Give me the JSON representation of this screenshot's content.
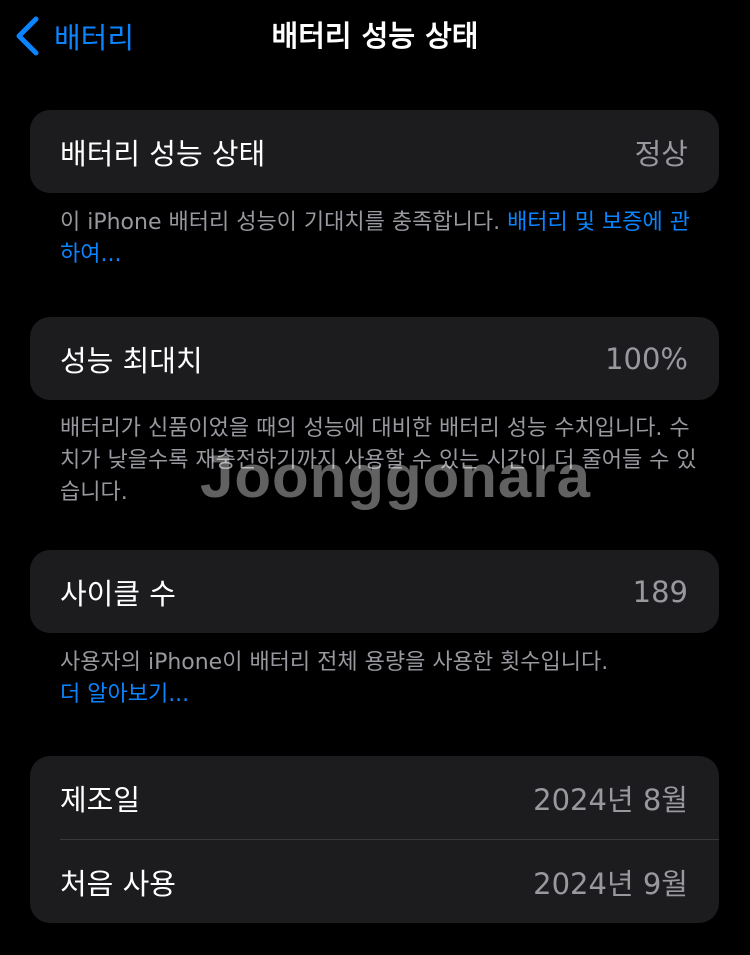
{
  "navbar": {
    "back_label": "배터리",
    "title": "배터리 성능 상태"
  },
  "health": {
    "label": "배터리 성능 상태",
    "value": "정상",
    "footnote": "이 iPhone 배터리 성능이 기대치를 충족합니다. ",
    "link": "배터리 및 보증에 관하여..."
  },
  "max_capacity": {
    "label": "성능 최대치",
    "value": "100%",
    "footnote": "배터리가 신품이었을 때의 성능에 대비한 배터리 성능 수치입니다. 수치가 낮을수록 재충전하기까지 사용할 수 있는 시간이 더 줄어들 수 있습니다."
  },
  "cycle_count": {
    "label": "사이클 수",
    "value": "189",
    "footnote": "사용자의 iPhone이 배터리 전체 용량을 사용한 횟수입니다.",
    "link": "더 알아보기..."
  },
  "dates": {
    "manufacture_label": "제조일",
    "manufacture_value": "2024년 8월",
    "first_use_label": "처음 사용",
    "first_use_value": "2024년 9월"
  },
  "watermark": "Joonggonara",
  "colors": {
    "background": "#000000",
    "card": "#1c1c1e",
    "accent": "#0a84ff",
    "secondary_text": "#98989f"
  }
}
